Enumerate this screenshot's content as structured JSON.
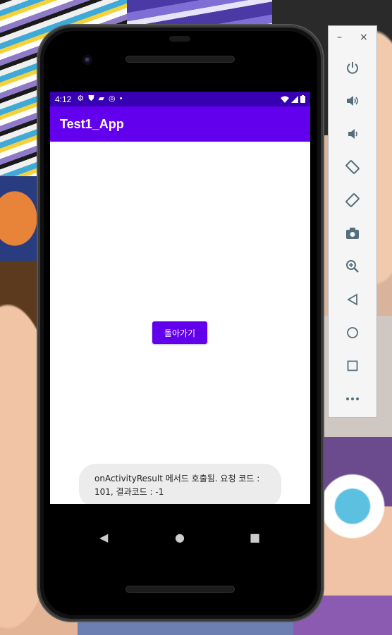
{
  "status_bar": {
    "time": "4:12",
    "left_icons": [
      "settings-icon",
      "shield-icon",
      "sd-card-icon",
      "data-saver-icon",
      "dot-icon"
    ],
    "right_icons": [
      "wifi-icon",
      "cell-signal-icon",
      "battery-icon"
    ]
  },
  "app_bar": {
    "title": "Test1_App"
  },
  "main": {
    "back_button_label": "돌아가기"
  },
  "toast": {
    "message": "onActivityResult 메서드 호출됨. 요청 코드 : 101, 결과코드 : -1"
  },
  "nav_bar": {
    "buttons": [
      "back-icon",
      "home-icon",
      "recents-icon"
    ]
  },
  "emulator_toolbar": {
    "window_controls": {
      "minimize": "–",
      "close": "×"
    },
    "buttons": [
      "power-icon",
      "volume-up-icon",
      "volume-down-icon",
      "rotate-left-icon",
      "rotate-right-icon",
      "camera-icon",
      "zoom-icon",
      "back-icon",
      "home-icon",
      "overview-icon",
      "more-icon"
    ]
  },
  "colors": {
    "status_bar": "#3700b3",
    "primary": "#6200ee",
    "toast_bg": "#ececec",
    "toolbar_icon": "#546e7a"
  }
}
